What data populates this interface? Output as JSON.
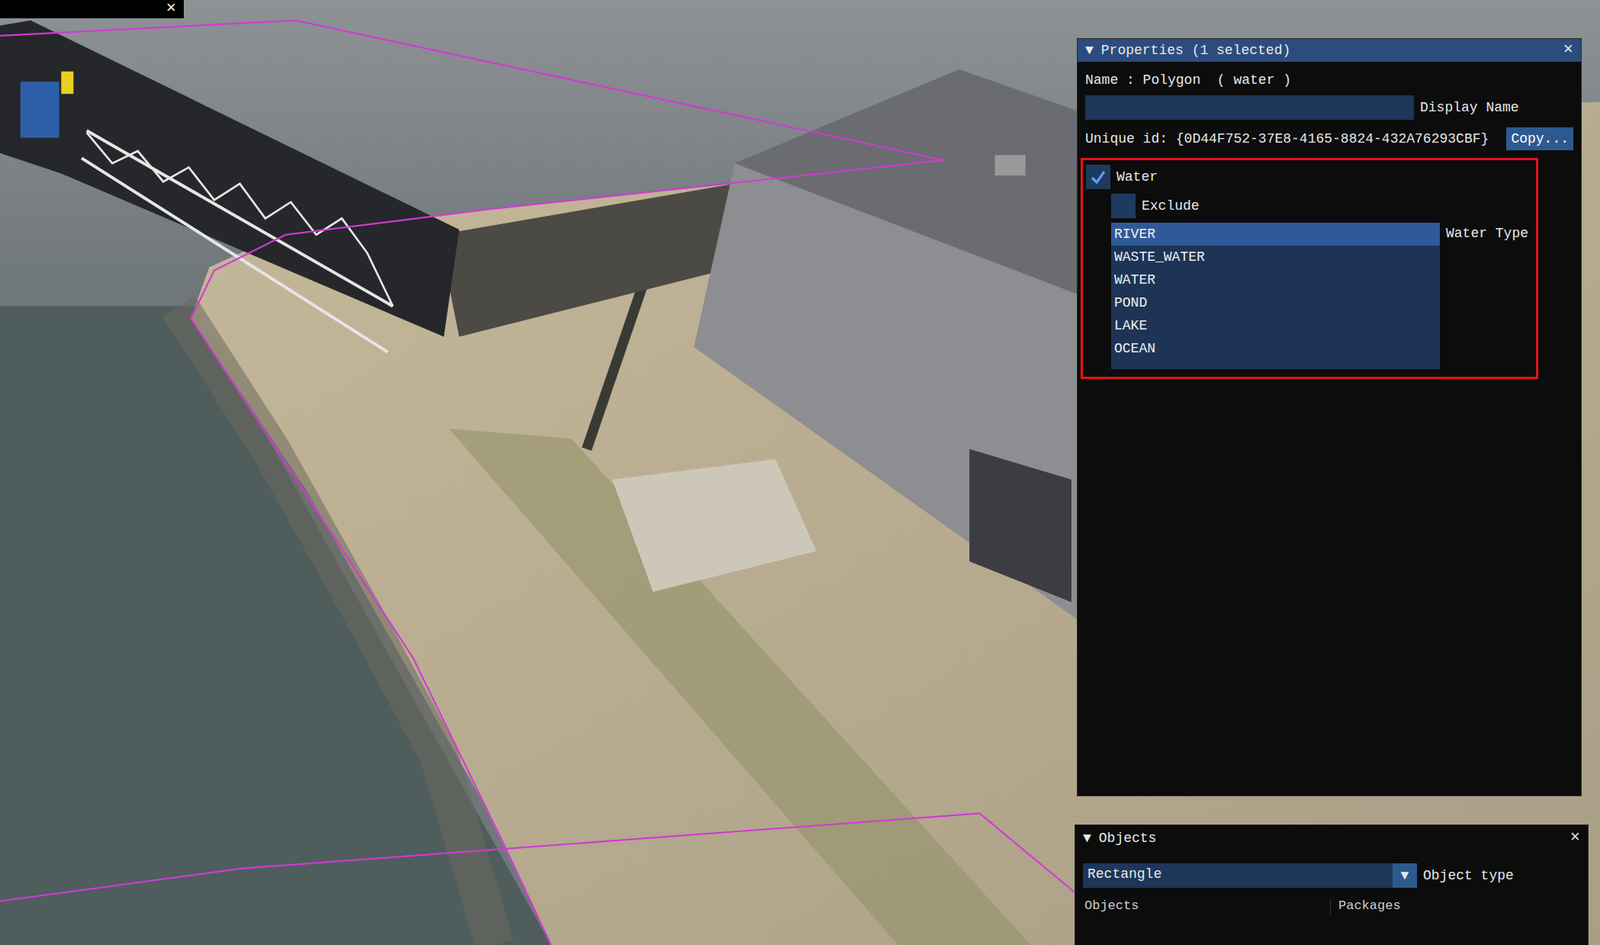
{
  "viewport": {
    "close_icon": "×"
  },
  "properties": {
    "collapse_icon": "▼",
    "title": "Properties (1 selected)",
    "close_icon": "×",
    "name_line": "Name : Polygon  ( water )",
    "display_name": {
      "value": "",
      "label": "Display Name"
    },
    "unique_id": "Unique id: {0D44F752-37E8-4165-8824-432A76293CBF}",
    "copy_button": "Copy...",
    "water_section": {
      "highlighted": true,
      "water": {
        "label": "Water",
        "checked": true
      },
      "exclude": {
        "label": "Exclude",
        "checked": false
      },
      "water_type": {
        "label": "Water Type",
        "options": [
          {
            "label": "RIVER",
            "selected": true
          },
          {
            "label": "WASTE_WATER",
            "selected": false
          },
          {
            "label": "WATER",
            "selected": false
          },
          {
            "label": "POND",
            "selected": false
          },
          {
            "label": "LAKE",
            "selected": false
          },
          {
            "label": "OCEAN",
            "selected": false
          }
        ]
      }
    }
  },
  "objects": {
    "collapse_icon": "▼",
    "title": "Objects",
    "close_icon": "×",
    "object_type": {
      "value": "Rectangle",
      "arrow": "▼",
      "label": "Object type"
    },
    "columns": [
      "Objects",
      "Packages"
    ]
  }
}
